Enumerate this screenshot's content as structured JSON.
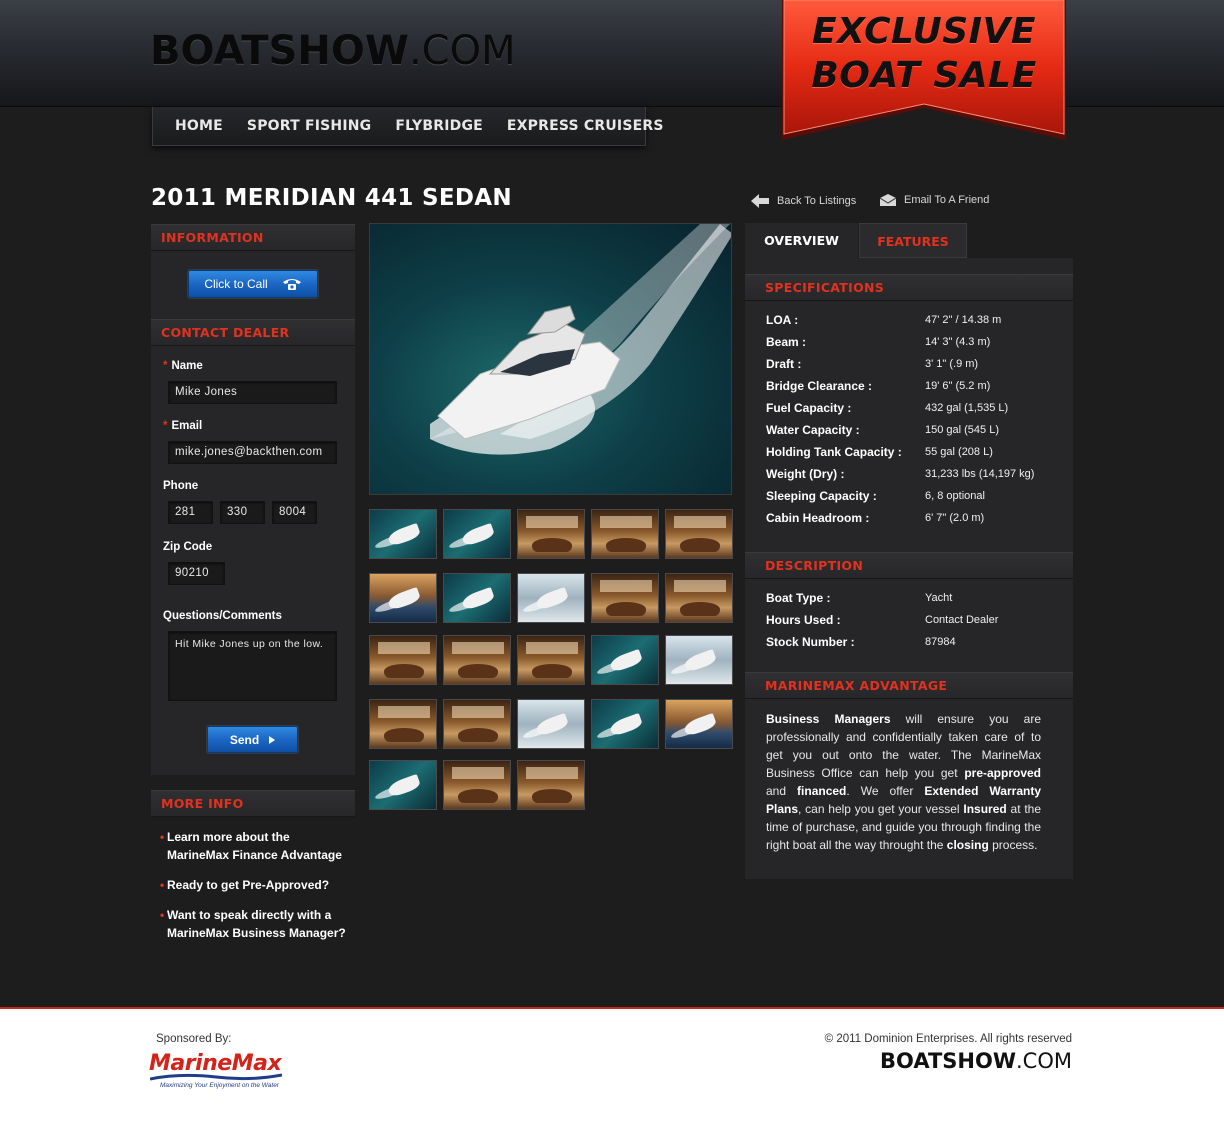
{
  "header": {
    "logo_bold": "BOATSHOW",
    "logo_rest": ".COM",
    "nav": [
      "HOME",
      "SPORT FISHING",
      "FLYBRIDGE",
      "EXPRESS CRUISERS"
    ],
    "ribbon_line1": "EXCLUSIVE",
    "ribbon_line2": "BOAT SALE"
  },
  "page_title": "2011 MERIDIAN 441 SEDAN",
  "top_links": {
    "back": "Back To Listings",
    "email": "Email To A Friend"
  },
  "sidebar": {
    "information_title": "INFORMATION",
    "call_button": "Click to Call",
    "contact_title": "CONTACT DEALER",
    "name_label": "Name",
    "name_value": "Mike Jones",
    "email_label": "Email",
    "email_value": "mike.jones@backthen.com",
    "phone_label": "Phone",
    "phone_area": "281",
    "phone_prefix": "330",
    "phone_line": "8004",
    "zip_label": "Zip Code",
    "zip_value": "90210",
    "comments_label": "Questions/Comments",
    "comments_value": "Hit Mike Jones up on the low.",
    "send_button": "Send",
    "more_info_title": "MORE INFO",
    "more_info": [
      "Learn more about the MarineMax Finance Advantage",
      "Ready to get Pre-Approved?",
      "Want to speak directly with a MarineMax Business Manager?"
    ]
  },
  "tabs": {
    "overview": "OVERVIEW",
    "features": "FEATURES"
  },
  "specifications": {
    "title": "SPECIFICATIONS",
    "rows": [
      {
        "key": "LOA :",
        "value": "47' 2\" / 14.38 m"
      },
      {
        "key": "Beam :",
        "value": "14' 3\" (4.3 m)"
      },
      {
        "key": "Draft :",
        "value": "3' 1\" (.9 m)"
      },
      {
        "key": "Bridge Clearance :",
        "value": "19' 6\" (5.2 m)"
      },
      {
        "key": "Fuel Capacity :",
        "value": "432 gal (1,535 L)"
      },
      {
        "key": "Water Capacity :",
        "value": "150 gal (545 L)"
      },
      {
        "key": "Holding Tank Capacity :",
        "value": "55 gal (208 L)"
      },
      {
        "key": "Weight (Dry) :",
        "value": "31,233 lbs (14,197 kg)"
      },
      {
        "key": "Sleeping Capacity :",
        "value": "6, 8 optional"
      },
      {
        "key": "Cabin Headroom :",
        "value": "6' 7\" (2.0 m)"
      }
    ]
  },
  "description": {
    "title": "DESCRIPTION",
    "rows": [
      {
        "key": "Boat Type :",
        "value": "Yacht"
      },
      {
        "key": "Hours Used :",
        "value": "Contact Dealer"
      },
      {
        "key": "Stock Number :",
        "value": "87984"
      }
    ]
  },
  "advantage": {
    "title": "MARINEMAX ADVANTAGE",
    "segments": [
      {
        "text": "Business Managers",
        "bold": true
      },
      {
        "text": " will ensure you are professionally and confidentially taken care of to get you out onto the water. The MarineMax Business Office can help you get ",
        "bold": false
      },
      {
        "text": "pre-approved",
        "bold": true
      },
      {
        "text": " and ",
        "bold": false
      },
      {
        "text": "financed",
        "bold": true
      },
      {
        "text": ". We offer ",
        "bold": false
      },
      {
        "text": "Extended Warranty Plans",
        "bold": true
      },
      {
        "text": ", can help you get your vessel ",
        "bold": false
      },
      {
        "text": "Insured",
        "bold": true
      },
      {
        "text": " at the time of purchase, and guide you through finding the right boat all the way throught the ",
        "bold": false
      },
      {
        "text": "closing",
        "bold": true
      },
      {
        "text": " process.",
        "bold": false
      }
    ]
  },
  "footer": {
    "sponsored": "Sponsored By:",
    "sponsor_name": "MarineMax",
    "sponsor_tag": "Maximizing Your Enjoyment on the Water",
    "copyright": "© 2011 Dominion Enterprises. All rights reserved",
    "logo_bold": "BOATSHOW",
    "logo_rest": ".COM"
  },
  "colors": {
    "accent_red": "#e0321e",
    "button_blue": "#1c67c4",
    "panel_bg": "#262628",
    "page_bg": "#1d1d1e"
  },
  "thumbnails": [
    "sea",
    "sea",
    "interior",
    "interior",
    "interior",
    "marina",
    "sea",
    "dock",
    "interior",
    "interior",
    "interior",
    "interior",
    "interior",
    "sea",
    "dock",
    "interior",
    "interior",
    "dock",
    "sea",
    "marina",
    "sea",
    "interior",
    "interior"
  ]
}
